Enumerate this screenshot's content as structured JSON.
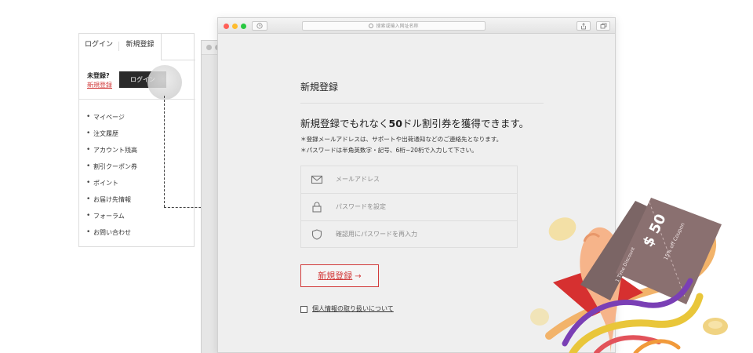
{
  "member_menu": {
    "tabs": {
      "login": "ログイン",
      "register": "新規登録"
    },
    "unregistered_text": "未登録?",
    "register_link": "新規登録",
    "login_button": "ログイン",
    "items": [
      {
        "label": "マイページ"
      },
      {
        "label": "注文履歴"
      },
      {
        "label": "アカウント残高"
      },
      {
        "label": "割引クーポン券"
      },
      {
        "label": "ポイント"
      },
      {
        "label": "お届け先情報"
      },
      {
        "label": "フォーラム"
      },
      {
        "label": "お問い合わせ"
      }
    ],
    "bullet": "•"
  },
  "browser": {
    "url_placeholder": "搜索或输入网址名称",
    "history_icon": "clock-icon",
    "share_icon": "share-icon",
    "tabs_icon": "tabs-icon"
  },
  "register_page": {
    "title": "新規登録",
    "headline_before": "新規登録でもれなく",
    "headline_bold": "50",
    "headline_after": "ドル割引券を獲得できます。",
    "notes": [
      "＊登録メールアドレスは、サポートや出荷通知などのご連絡先となります。",
      "＊パスワードは半角英数字・記号、6桁~20桁で入力して下さい。"
    ],
    "fields": [
      {
        "placeholder": "メールアドレス",
        "icon": "mail-icon"
      },
      {
        "placeholder": "パスワードを設定",
        "icon": "lock-icon"
      },
      {
        "placeholder": "確認用にパスワードを再入力",
        "icon": "shield-icon"
      }
    ],
    "submit_label": "新規登録",
    "submit_arrow": "→",
    "privacy_label": "個人情報の取り扱いについて"
  },
  "promo": {
    "coupon_amount": "$ 50",
    "coupon_sub": "15% off Coupon",
    "stub_text": "1 Time Discount"
  },
  "colors": {
    "accent": "#d23b3b",
    "dark_button": "#2a2a2a",
    "coupon": "#8a7070"
  }
}
